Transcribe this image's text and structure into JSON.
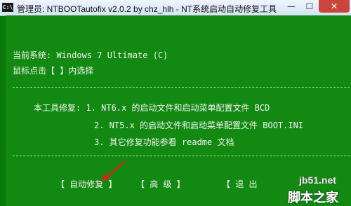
{
  "window": {
    "icon_text": "C:\\",
    "title": "管理员:  NTBOOTautofix v2.0.2 by chz_hlh - NT系统启动自动修复工具",
    "minimize": "—",
    "maximize": "☐",
    "close": "✕"
  },
  "console": {
    "current_system": "当前系统: Windows 7 Ultimate  (C)",
    "prompt": "鼠标点击【 】内选择",
    "intro": "本工具修复:  1. NT6.x 的启动文件和启动菜单配置文件 BCD",
    "item2": "2. NT5.x 的启动文件和启动菜单配置文件 BOOT.INI",
    "item3": "3. 其它修复功能参看 readme 文档",
    "btn_auto": "【 自动修复 】",
    "btn_advanced": "【  高  级  】",
    "btn_exit": "【  退  出"
  },
  "watermark": {
    "site": "jb51.net",
    "name": "脚本之家"
  }
}
